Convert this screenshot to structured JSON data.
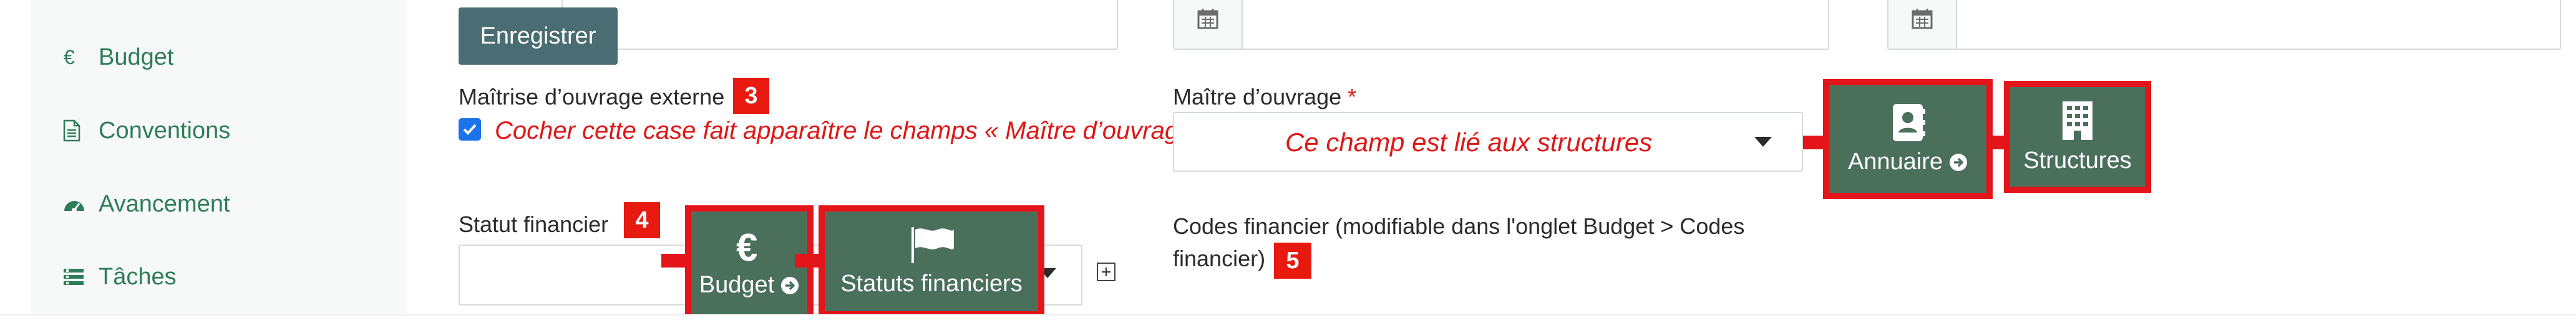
{
  "sidebar": {
    "items": [
      {
        "label": "Budget",
        "icon": "euro-icon"
      },
      {
        "label": "Conventions",
        "icon": "document-icon"
      },
      {
        "label": "Avancement",
        "icon": "dashboard-icon"
      },
      {
        "label": "Tâches",
        "icon": "tasks-icon"
      }
    ]
  },
  "form": {
    "save_label": "Enregistrer",
    "maitrise_label": "Maîtrise d’ouvrage externe",
    "maitrise_badge": "3",
    "maitrise_checked": true,
    "maitrise_note": "Cocher cette case fait apparaître le champs « Maître d’ouvrage »",
    "maitre_label": "Maître d’ouvrage",
    "required_mark": "*",
    "maitre_note": "Ce champ est lié aux structures",
    "statut_label": "Statut financier",
    "statut_badge": "4",
    "codes_label_line1": "Codes financier (modifiable dans l'onglet Budget > Codes",
    "codes_label_line2": "financier)",
    "codes_badge": "5"
  },
  "tiles": {
    "budget": {
      "label": "Budget",
      "icon": "euro-icon"
    },
    "statuts": {
      "label": "Statuts financiers",
      "icon": "flag-icon"
    },
    "annuaire": {
      "label": "Annuaire",
      "icon": "contact-book-icon"
    },
    "structures": {
      "label": "Structures",
      "icon": "building-icon"
    }
  },
  "colors": {
    "accent_green": "#2e7d5a",
    "tile_bg": "#4a6f5b",
    "highlight_red": "#e4151a",
    "save_bg": "#4a6c73",
    "note_red": "#e01616"
  }
}
